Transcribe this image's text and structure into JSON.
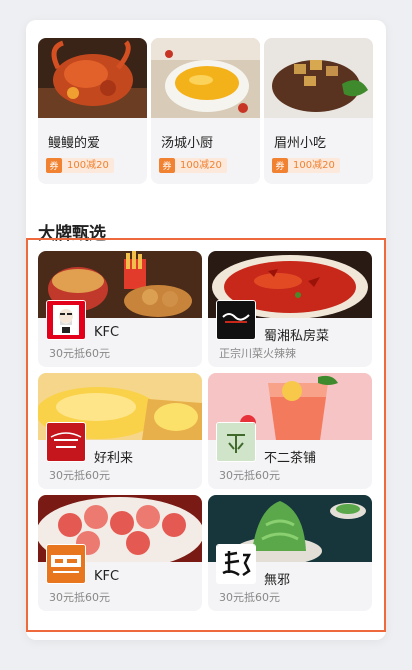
{
  "featured": [
    {
      "name": "鳗鳗的爱",
      "coupon_tag": "券",
      "coupon": "100减20",
      "photo_icon": "crawfish-photo"
    },
    {
      "name": "汤城小厨",
      "coupon_tag": "券",
      "coupon": "100减20",
      "photo_icon": "soup-bowl-photo"
    },
    {
      "name": "眉州小吃",
      "coupon_tag": "券",
      "coupon": "100减20",
      "photo_icon": "steak-photo"
    }
  ],
  "section_title": "大牌甄选",
  "brands": [
    {
      "name": "KFC",
      "desc": "30元抵60元",
      "logo_icon": "kfc-logo"
    },
    {
      "name": "蜀湘私房菜",
      "desc": "正宗川菜火辣辣",
      "logo_icon": "shuxiang-logo"
    },
    {
      "name": "好利来",
      "desc": "30元抵60元",
      "logo_icon": "holiland-logo",
      "logo_text": "好利来"
    },
    {
      "name": "不二茶铺",
      "desc": "30元抵60元",
      "logo_icon": "buer-tea-logo"
    },
    {
      "name": "KFC",
      "desc": "30元抵60元",
      "logo_icon": "hotpot-logo"
    },
    {
      "name": "無邪",
      "desc": "30元抵60元",
      "logo_icon": "wuxie-logo"
    }
  ],
  "colors": {
    "accent": "#f08232",
    "frame": "#ee6a3c"
  }
}
